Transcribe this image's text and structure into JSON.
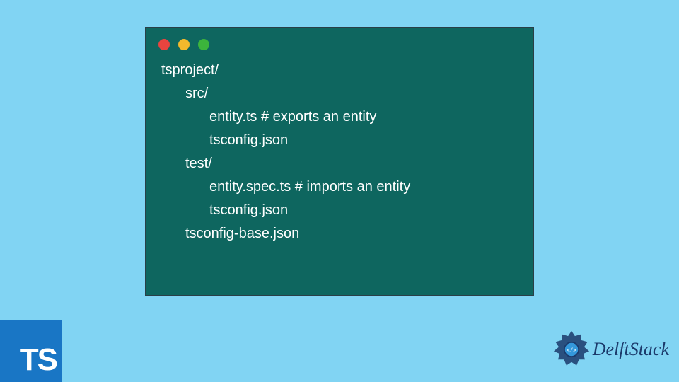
{
  "code": {
    "lines": [
      {
        "text": "tsproject/",
        "indent": 1
      },
      {
        "text": "src/",
        "indent": 2
      },
      {
        "text": "entity.ts # exports an entity",
        "indent": 3
      },
      {
        "text": "tsconfig.json",
        "indent": 3
      },
      {
        "text": "test/",
        "indent": 2
      },
      {
        "text": "entity.spec.ts # imports an entity",
        "indent": 3
      },
      {
        "text": "tsconfig.json",
        "indent": 3
      },
      {
        "text": "tsconfig-base.json",
        "indent": 2
      }
    ]
  },
  "ts_badge": {
    "label": "TS"
  },
  "delft": {
    "label": "DelftStack"
  }
}
